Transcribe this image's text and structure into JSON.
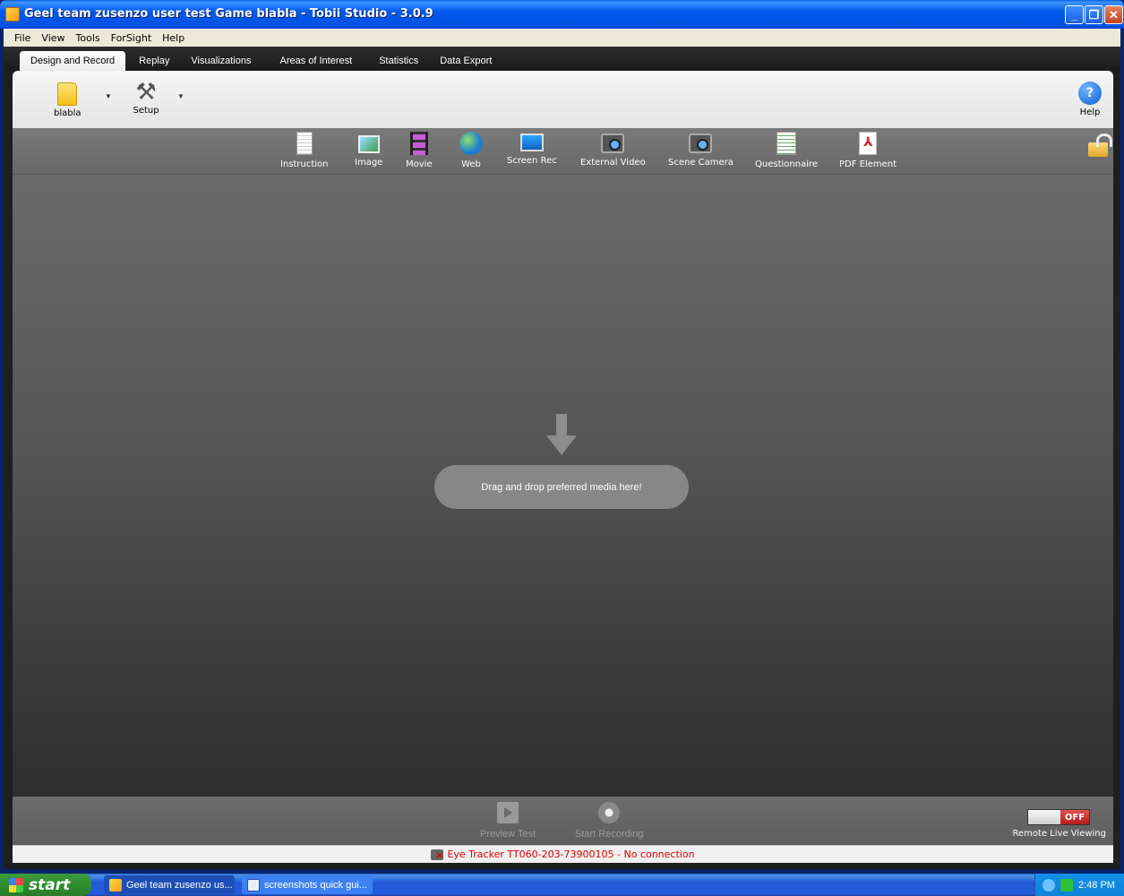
{
  "window": {
    "title": "Geel team zusenzo user test Game blabla - Tobii Studio - 3.0.9",
    "minimize_glyph": "_",
    "restore_glyph": "❐",
    "close_glyph": "✕"
  },
  "menu": [
    "File",
    "View",
    "Tools",
    "ForSight",
    "Help"
  ],
  "tabs": [
    {
      "label": "Design and Record",
      "active": true
    },
    {
      "label": "Replay"
    },
    {
      "label": "Visualizations"
    },
    {
      "label": "Areas of Interest"
    },
    {
      "label": "Statistics"
    },
    {
      "label": "Data Export"
    }
  ],
  "ribbon": {
    "test_label": "blabla",
    "setup_label": "Setup",
    "help_label": "Help",
    "help_glyph": "?"
  },
  "media": [
    {
      "label": "Instruction",
      "icon": "instruction-icon"
    },
    {
      "label": "Image",
      "icon": "image-icon"
    },
    {
      "label": "Movie",
      "icon": "movie-icon"
    },
    {
      "label": "Web",
      "icon": "web-icon"
    },
    {
      "label": "Screen Rec",
      "icon": "screen-rec-icon"
    },
    {
      "label": "External Video",
      "icon": "external-video-icon"
    },
    {
      "label": "Scene Camera",
      "icon": "scene-camera-icon"
    },
    {
      "label": "Questionnaire",
      "icon": "questionnaire-icon"
    },
    {
      "label": "PDF Element",
      "icon": "pdf-icon"
    }
  ],
  "drop": {
    "text": "Drag and drop preferred media here!"
  },
  "bottom": {
    "preview_label": "Preview Test",
    "record_label": "Start Recording",
    "toggle_state": "OFF",
    "remote_label": "Remote Live Viewing"
  },
  "status": {
    "text": "Eye Tracker TT060-203-73900105 - No connection"
  },
  "taskbar": {
    "start_label": "start",
    "tasks": [
      "Geel team zusenzo us...",
      "screenshots quick gui..."
    ],
    "clock": "2:48 PM"
  },
  "colors": {
    "accent_blue": "#0054e3",
    "status_red": "#e00000",
    "toggle_red": "#c42a2a"
  }
}
